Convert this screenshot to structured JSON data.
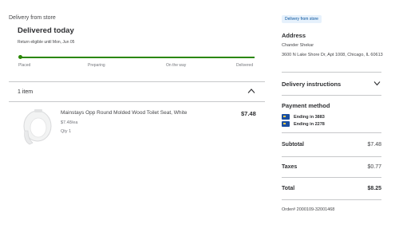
{
  "fulfillment": {
    "type": "Delivery from store",
    "status_title": "Delivered today",
    "return_note": "Return eligible until Mon, Jun 05",
    "progress": {
      "steps": [
        "Placed",
        "Preparing",
        "On the way",
        "Delivered"
      ],
      "current_step": "Delivered",
      "color": "#2a8703"
    }
  },
  "items": {
    "count_label": "1 item",
    "list": [
      {
        "name": "Mainstays Opp Round Molded Wood Toilet Seat, White",
        "unit_price": "$7.48/ea",
        "qty": "Qty 1",
        "price": "$7.48",
        "image": "toilet-seat"
      }
    ]
  },
  "sidebar": {
    "badge": "Delivery from store",
    "address": {
      "title": "Address",
      "name": "Chander Shekar",
      "line": "3600 N Lake Shore Dr, Apt 1008, Chicago, IL 60613"
    },
    "delivery_instructions": "Delivery instructions",
    "payment": {
      "title": "Payment method",
      "cards": [
        "Ending in 3883",
        "Ending in 2278"
      ]
    },
    "summary": {
      "subtotal_label": "Subtotal",
      "subtotal_value": "$7.48",
      "taxes_label": "Taxes",
      "taxes_value": "$0.77",
      "total_label": "Total",
      "total_value": "$8.25"
    },
    "order_number": "Order# 2000109-32001468"
  },
  "colors": {
    "accent": "#2a8703",
    "badge_bg": "#e6f1fc",
    "badge_text": "#004f9a",
    "card": "#1a4fa0"
  }
}
